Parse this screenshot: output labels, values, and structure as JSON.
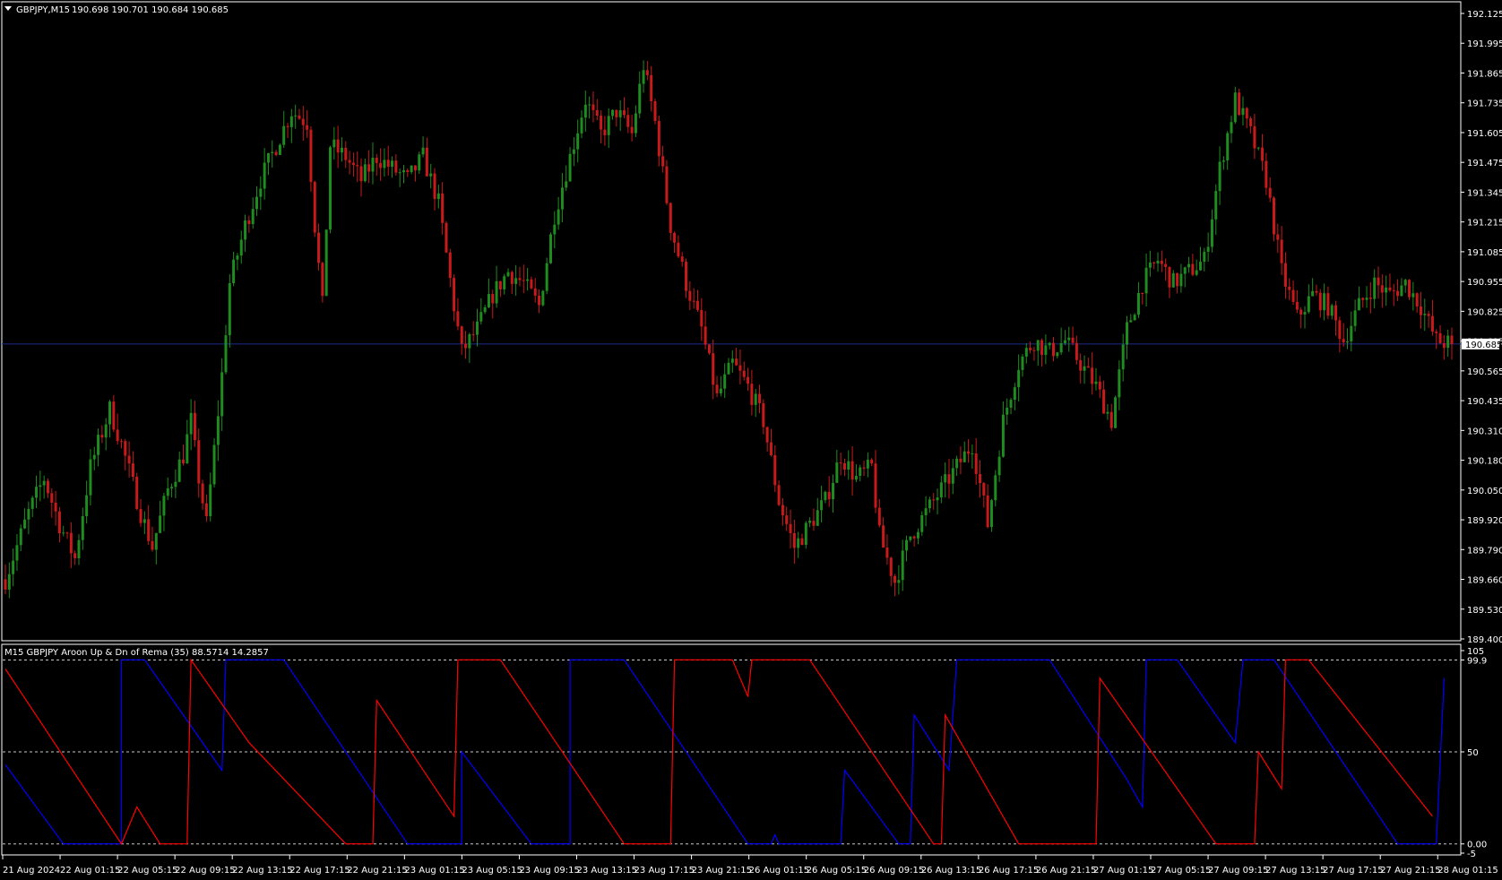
{
  "main_panel": {
    "title": "GBPJPY,M15",
    "ohlc": "190.698 190.701 190.684 190.685",
    "price_axis": [
      "192.125",
      "191.995",
      "191.865",
      "191.735",
      "191.605",
      "191.475",
      "191.345",
      "191.215",
      "191.085",
      "190.955",
      "190.825",
      "190.695",
      "190.565",
      "190.435",
      "190.310",
      "190.180",
      "190.050",
      "189.920",
      "189.790",
      "189.660",
      "189.530",
      "189.400"
    ],
    "current_price": "190.685",
    "colors": {
      "bull": "#1e8c1e",
      "bear": "#c81a1a",
      "hline": "#1c2c8c",
      "border": "#ffffff"
    }
  },
  "indicator_panel": {
    "title": "M15 GBPJPY Aroon Up & Dn of Rema (35) 88.5714 14.2857",
    "axis": [
      "105",
      "99.9",
      "50",
      "0.00",
      "-5"
    ],
    "colors": {
      "up": "#0000ff",
      "down": "#ff0000"
    }
  },
  "time_axis": [
    "21 Aug 2024",
    "22 Aug 01:15",
    "22 Aug 05:15",
    "22 Aug 09:15",
    "22 Aug 13:15",
    "22 Aug 17:15",
    "22 Aug 21:15",
    "23 Aug 01:15",
    "23 Aug 05:15",
    "23 Aug 09:15",
    "23 Aug 13:15",
    "23 Aug 17:15",
    "23 Aug 21:15",
    "26 Aug 01:15",
    "26 Aug 05:15",
    "26 Aug 09:15",
    "26 Aug 13:15",
    "26 Aug 17:15",
    "26 Aug 21:15",
    "27 Aug 01:15",
    "27 Aug 05:15",
    "27 Aug 09:15",
    "27 Aug 13:15",
    "27 Aug 17:15",
    "27 Aug 21:15",
    "28 Aug 01:15"
  ],
  "chart_data": [
    {
      "type": "candlestick",
      "symbol": "GBPJPY",
      "timeframe": "M15",
      "ylim": [
        189.4,
        192.125
      ],
      "close_path": [
        [
          0,
          189.66
        ],
        [
          6,
          189.95
        ],
        [
          10,
          190.1
        ],
        [
          14,
          189.9
        ],
        [
          18,
          189.75
        ],
        [
          22,
          190.15
        ],
        [
          27,
          190.4
        ],
        [
          30,
          190.25
        ],
        [
          35,
          189.95
        ],
        [
          38,
          189.8
        ],
        [
          42,
          190.05
        ],
        [
          46,
          190.2
        ],
        [
          48,
          190.35
        ],
        [
          50,
          190.1
        ],
        [
          52,
          189.9
        ],
        [
          56,
          190.55
        ],
        [
          58,
          190.95
        ],
        [
          62,
          191.2
        ],
        [
          66,
          191.4
        ],
        [
          70,
          191.55
        ],
        [
          74,
          191.7
        ],
        [
          78,
          191.65
        ],
        [
          80,
          191.2
        ],
        [
          82,
          190.85
        ],
        [
          84,
          191.55
        ],
        [
          88,
          191.5
        ],
        [
          92,
          191.4
        ],
        [
          96,
          191.5
        ],
        [
          100,
          191.45
        ],
        [
          104,
          191.4
        ],
        [
          108,
          191.5
        ],
        [
          112,
          191.3
        ],
        [
          116,
          190.85
        ],
        [
          118,
          190.65
        ],
        [
          122,
          190.75
        ],
        [
          126,
          190.9
        ],
        [
          130,
          191.0
        ],
        [
          134,
          190.95
        ],
        [
          138,
          190.85
        ],
        [
          142,
          191.25
        ],
        [
          146,
          191.5
        ],
        [
          150,
          191.75
        ],
        [
          154,
          191.6
        ],
        [
          158,
          191.7
        ],
        [
          162,
          191.6
        ],
        [
          165,
          191.9
        ],
        [
          168,
          191.65
        ],
        [
          172,
          191.2
        ],
        [
          176,
          190.95
        ],
        [
          180,
          190.75
        ],
        [
          184,
          190.45
        ],
        [
          188,
          190.6
        ],
        [
          192,
          190.5
        ],
        [
          196,
          190.35
        ],
        [
          200,
          190.0
        ],
        [
          204,
          189.8
        ],
        [
          208,
          189.9
        ],
        [
          212,
          190.0
        ],
        [
          216,
          190.2
        ],
        [
          220,
          190.1
        ],
        [
          224,
          190.15
        ],
        [
          226,
          189.85
        ],
        [
          230,
          189.65
        ],
        [
          234,
          189.85
        ],
        [
          238,
          189.95
        ],
        [
          242,
          190.05
        ],
        [
          246,
          190.15
        ],
        [
          250,
          190.25
        ],
        [
          254,
          189.9
        ],
        [
          258,
          190.35
        ],
        [
          262,
          190.6
        ],
        [
          266,
          190.7
        ],
        [
          270,
          190.65
        ],
        [
          274,
          190.7
        ],
        [
          278,
          190.6
        ],
        [
          282,
          190.5
        ],
        [
          286,
          190.35
        ],
        [
          290,
          190.75
        ],
        [
          294,
          190.95
        ],
        [
          298,
          191.05
        ],
        [
          302,
          190.95
        ],
        [
          306,
          191.0
        ],
        [
          310,
          191.05
        ],
        [
          314,
          191.45
        ],
        [
          318,
          191.75
        ],
        [
          322,
          191.6
        ],
        [
          326,
          191.4
        ],
        [
          330,
          191.0
        ],
        [
          334,
          190.8
        ],
        [
          338,
          190.9
        ],
        [
          342,
          190.85
        ],
        [
          346,
          190.7
        ],
        [
          350,
          190.85
        ],
        [
          354,
          190.95
        ],
        [
          358,
          190.9
        ],
        [
          362,
          190.95
        ],
        [
          366,
          190.85
        ],
        [
          370,
          190.7
        ],
        [
          374,
          190.685
        ]
      ],
      "last_close": 190.685
    },
    {
      "type": "line",
      "title": "M15 GBPJPY Aroon Up & Dn of Rema (35) 88.5714 14.2857",
      "ylim": [
        -5,
        105
      ],
      "levels": [
        99.9,
        50,
        0
      ],
      "series": [
        {
          "name": "Aroon Up",
          "points": [
            [
              0,
              43
            ],
            [
              15,
              0
            ],
            [
              30,
              0
            ],
            [
              30,
              100
            ],
            [
              36,
              100
            ],
            [
              56,
              40
            ],
            [
              57,
              100
            ],
            [
              72,
              100
            ],
            [
              104,
              0
            ],
            [
              118,
              0
            ],
            [
              118,
              50
            ],
            [
              136,
              0
            ],
            [
              146,
              0
            ],
            [
              146,
              100
            ],
            [
              160,
              100
            ],
            [
              192,
              0
            ],
            [
              198,
              0
            ],
            [
              199,
              5
            ],
            [
              200,
              0
            ],
            [
              216,
              0
            ],
            [
              217,
              40
            ],
            [
              231,
              0
            ],
            [
              234,
              0
            ],
            [
              235,
              70
            ],
            [
              244,
              40
            ],
            [
              246,
              100
            ],
            [
              270,
              100
            ],
            [
              290,
              35
            ],
            [
              294,
              20
            ],
            [
              295,
              100
            ],
            [
              303,
              100
            ],
            [
              318,
              55
            ],
            [
              320,
              100
            ],
            [
              328,
              100
            ],
            [
              360,
              0
            ],
            [
              370,
              0
            ],
            [
              372,
              90
            ]
          ]
        },
        {
          "name": "Aroon Dn",
          "points": [
            [
              0,
              95
            ],
            [
              30,
              0
            ],
            [
              34,
              20
            ],
            [
              40,
              0
            ],
            [
              47,
              0
            ],
            [
              48,
              100
            ],
            [
              63,
              55
            ],
            [
              88,
              0
            ],
            [
              95,
              0
            ],
            [
              96,
              78
            ],
            [
              116,
              15
            ],
            [
              117,
              100
            ],
            [
              128,
              100
            ],
            [
              160,
              0
            ],
            [
              172,
              0
            ],
            [
              173,
              100
            ],
            [
              188,
              100
            ],
            [
              192,
              80
            ],
            [
              193,
              100
            ],
            [
              208,
              100
            ],
            [
              240,
              0
            ],
            [
              242,
              0
            ],
            [
              243,
              70
            ],
            [
              262,
              0
            ],
            [
              282,
              0
            ],
            [
              283,
              90
            ],
            [
              313,
              0
            ],
            [
              323,
              0
            ],
            [
              324,
              50
            ],
            [
              330,
              30
            ],
            [
              331,
              100
            ],
            [
              337,
              100
            ],
            [
              369,
              15
            ]
          ]
        }
      ]
    }
  ]
}
